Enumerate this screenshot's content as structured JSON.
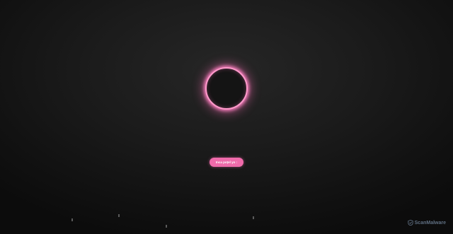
{
  "cta": {
    "label": "Inca poțel yo :"
  },
  "watermark": {
    "text": "ScanMalware"
  },
  "colors": {
    "accent": "#ff9acb",
    "button": "#f06bab",
    "background": "#1b1b1b"
  },
  "icons": {
    "ring": "glowing-ring",
    "watermark": "scanmalware-logo"
  }
}
